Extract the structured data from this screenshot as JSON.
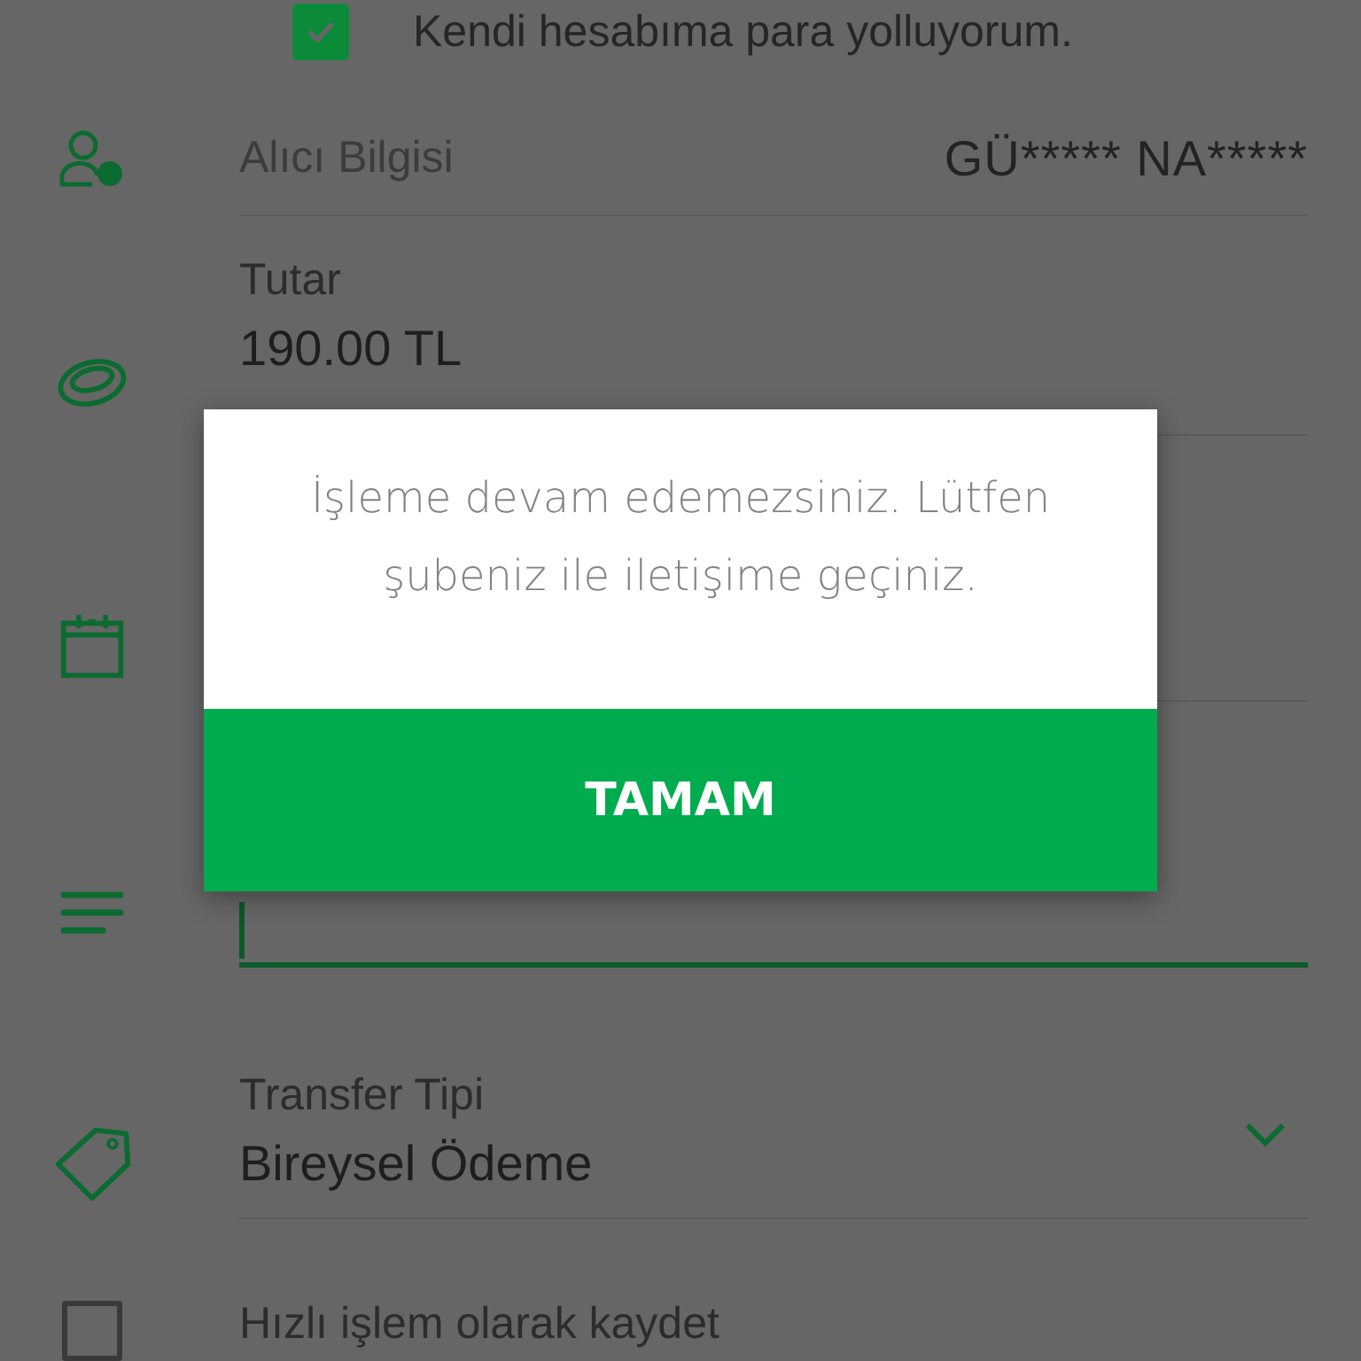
{
  "top_option": {
    "label": "Kendi hesabıma para yolluyorum.",
    "checked": true
  },
  "recipient": {
    "label": "Alıcı Bilgisi",
    "value": "GÜ***** NA*****"
  },
  "amount": {
    "label": "Tutar",
    "value": "190.00 TL"
  },
  "description": {
    "focused": true
  },
  "transfer_type": {
    "label": "Transfer Tipi",
    "value": "Bireysel Ödeme"
  },
  "quick_save": {
    "label": "Hızlı işlem olarak kaydet",
    "checked": false
  },
  "dialog": {
    "message": "İşleme devam edemezsiniz. Lütfen şubeniz ile iletişime geçiniz.",
    "button": "TAMAM"
  }
}
